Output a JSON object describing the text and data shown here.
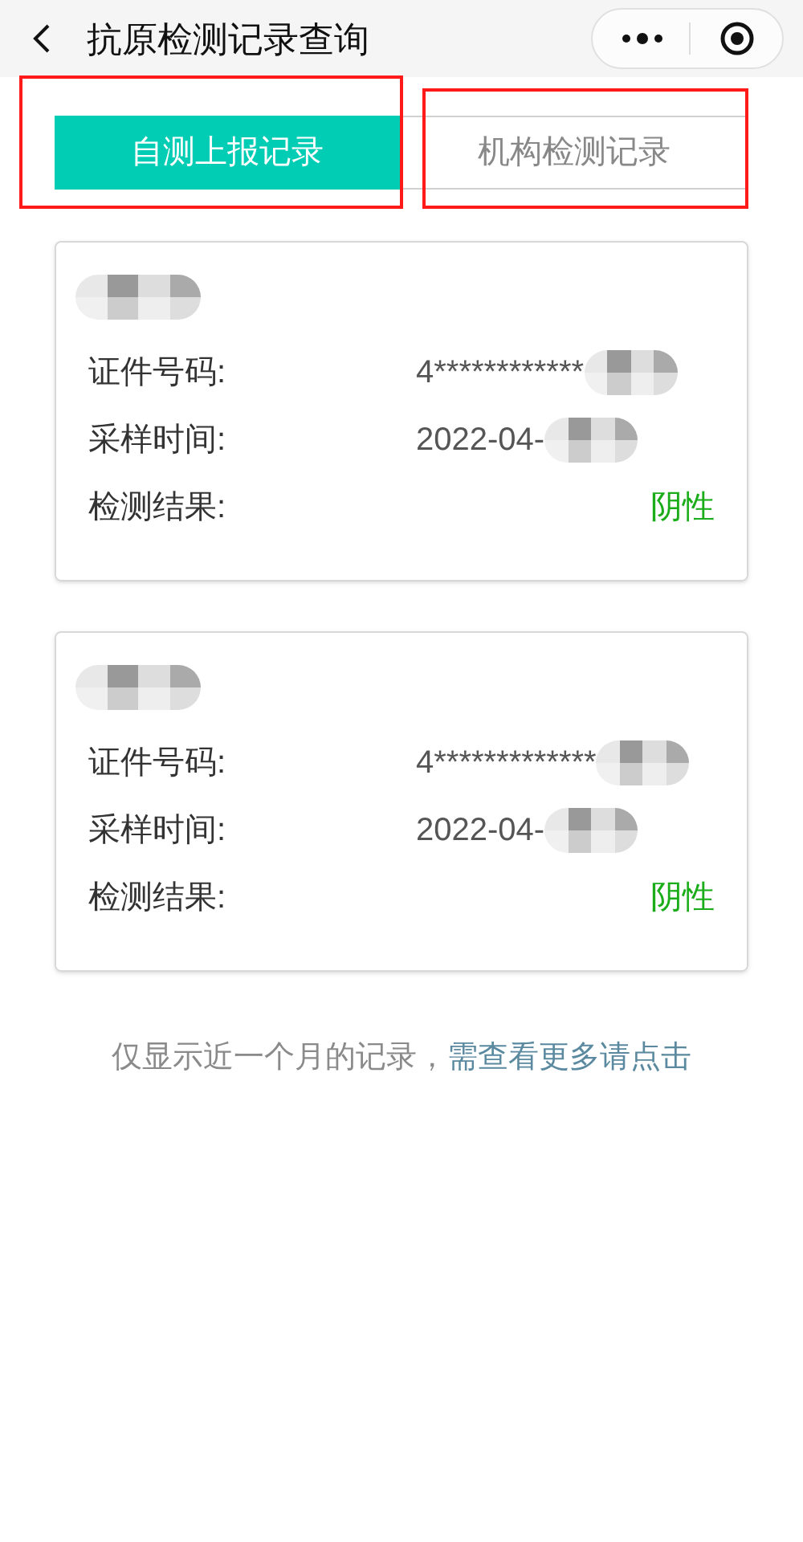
{
  "window": {
    "title": "抗原检测记录查询"
  },
  "tabs": [
    {
      "label": "自测上报记录",
      "selected": true,
      "highlighted": true
    },
    {
      "label": "机构检测记录",
      "selected": false,
      "highlighted": true
    }
  ],
  "records": [
    {
      "name_redacted": true,
      "fields": [
        {
          "label": "证件号码:",
          "value": "4************",
          "redacted": true,
          "kind": "text"
        },
        {
          "label": "采样时间:",
          "value": "2022-04-",
          "redacted": true,
          "kind": "text"
        },
        {
          "label": "检测结果:",
          "value": "阴性",
          "redacted": false,
          "kind": "result"
        }
      ]
    },
    {
      "name_redacted": true,
      "fields": [
        {
          "label": "证件号码:",
          "value": "4*************",
          "redacted": true,
          "kind": "text"
        },
        {
          "label": "采样时间:",
          "value": "2022-04-",
          "redacted": true,
          "kind": "text"
        },
        {
          "label": "检测结果:",
          "value": "阴性",
          "redacted": false,
          "kind": "result"
        }
      ]
    }
  ],
  "footer": {
    "text": "仅显示近一个月的记录，",
    "link": "需查看更多请点击"
  }
}
